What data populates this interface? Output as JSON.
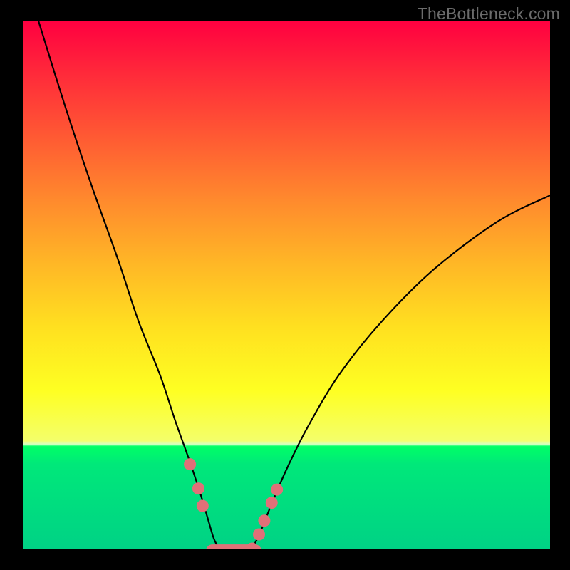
{
  "watermark": "TheBottleneck.com",
  "chart_data": {
    "type": "line",
    "title": "",
    "xlabel": "",
    "ylabel": "",
    "xlim": [
      0,
      100
    ],
    "ylim": [
      0,
      100
    ],
    "grid": false,
    "legend": false,
    "series": [
      {
        "name": "left-curve",
        "x": [
          3,
          8,
          13,
          18,
          22,
          26,
          29,
          31.5,
          33.5,
          35,
          36.2,
          37.2
        ],
        "y": [
          100,
          84,
          69,
          55,
          43,
          33,
          24,
          17,
          11,
          6,
          2,
          0
        ]
      },
      {
        "name": "right-curve",
        "x": [
          43.5,
          45,
          47,
          50,
          54,
          60,
          68,
          78,
          90,
          100
        ],
        "y": [
          0,
          3,
          8,
          15,
          23,
          33,
          43,
          53,
          62,
          67
        ]
      },
      {
        "name": "bottom-segment",
        "x": [
          34.5,
          45.5
        ],
        "y": [
          -0.5,
          -0.5
        ]
      }
    ],
    "markers": {
      "name": "data-points",
      "color": "#e07078",
      "points": [
        {
          "x": 31.7,
          "y": 16.0
        },
        {
          "x": 33.3,
          "y": 11.4
        },
        {
          "x": 34.1,
          "y": 8.1
        },
        {
          "x": 43.5,
          "y": 0.0
        },
        {
          "x": 44.8,
          "y": 2.7
        },
        {
          "x": 45.8,
          "y": 5.3
        },
        {
          "x": 47.2,
          "y": 8.7
        },
        {
          "x": 48.2,
          "y": 11.2
        }
      ],
      "capsule": {
        "y": -0.5,
        "x0": 34.7,
        "x1": 45.3,
        "thickness": 2.6
      }
    },
    "colors": {
      "curve": "#000000",
      "marker_fill": "#e07078",
      "capsule_fill": "#e07078"
    }
  }
}
